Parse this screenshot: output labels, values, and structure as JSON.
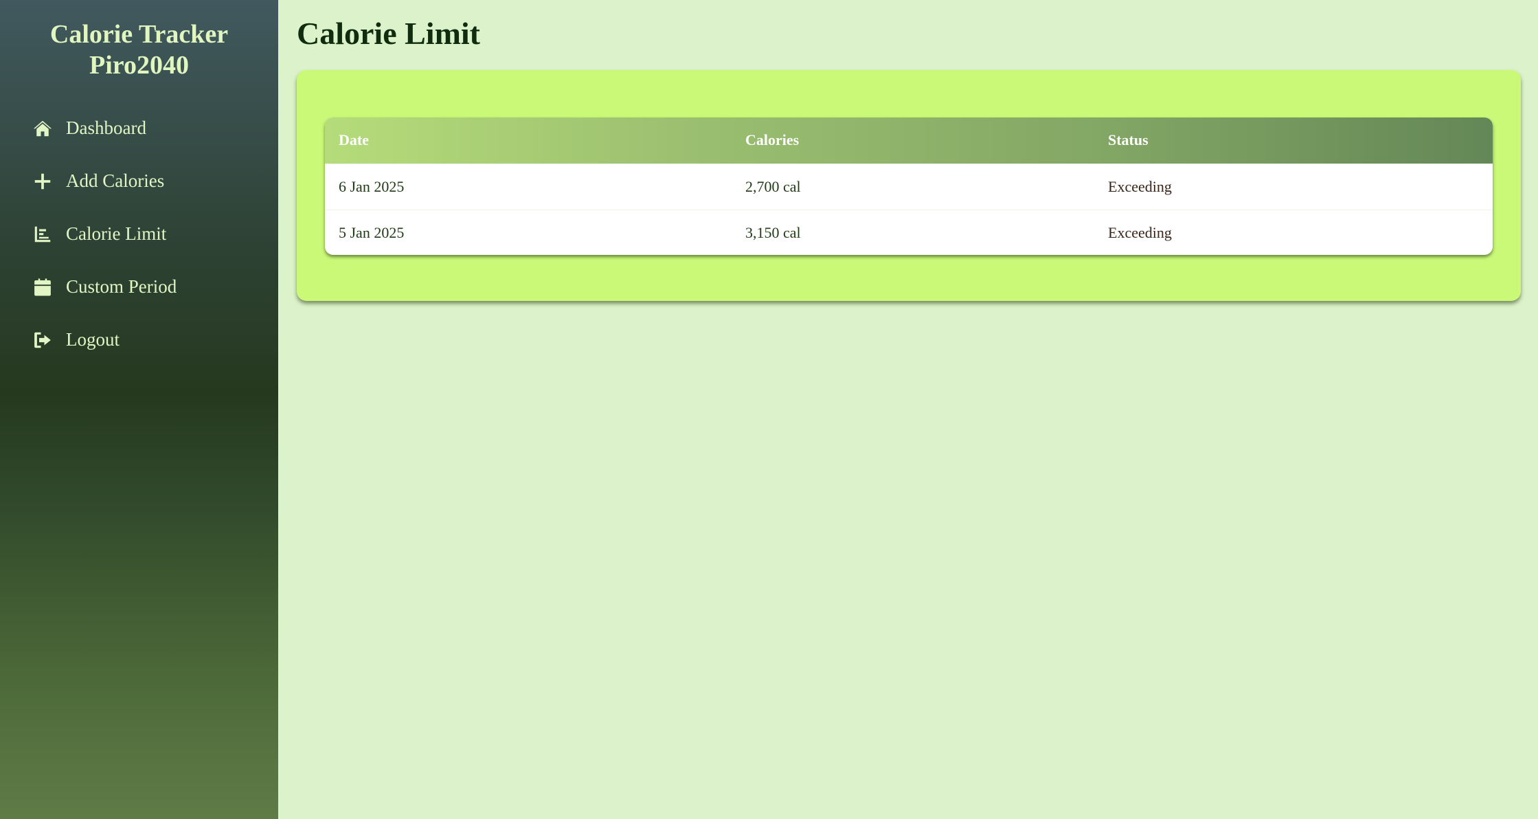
{
  "sidebar": {
    "brand_line1": "Calorie Tracker",
    "brand_line2": "Piro2040",
    "items": [
      {
        "label": "Dashboard",
        "icon": "home-icon"
      },
      {
        "label": "Add Calories",
        "icon": "plus-icon"
      },
      {
        "label": "Calorie Limit",
        "icon": "chart-icon"
      },
      {
        "label": "Custom Period",
        "icon": "calendar-icon"
      },
      {
        "label": "Logout",
        "icon": "logout-icon"
      }
    ]
  },
  "main": {
    "title": "Calorie Limit",
    "table": {
      "headers": [
        "Date",
        "Calories",
        "Status"
      ],
      "rows": [
        [
          "6 Jan 2025",
          "2,700 cal",
          "Exceeding"
        ],
        [
          "5 Jan 2025",
          "3,150 cal",
          "Exceeding"
        ]
      ]
    }
  },
  "colors": {
    "page_bg": "#dcf2ca",
    "card_bg": "#c9f977",
    "sidebar_text": "#e2f5c4",
    "title_text": "#102c0e"
  }
}
